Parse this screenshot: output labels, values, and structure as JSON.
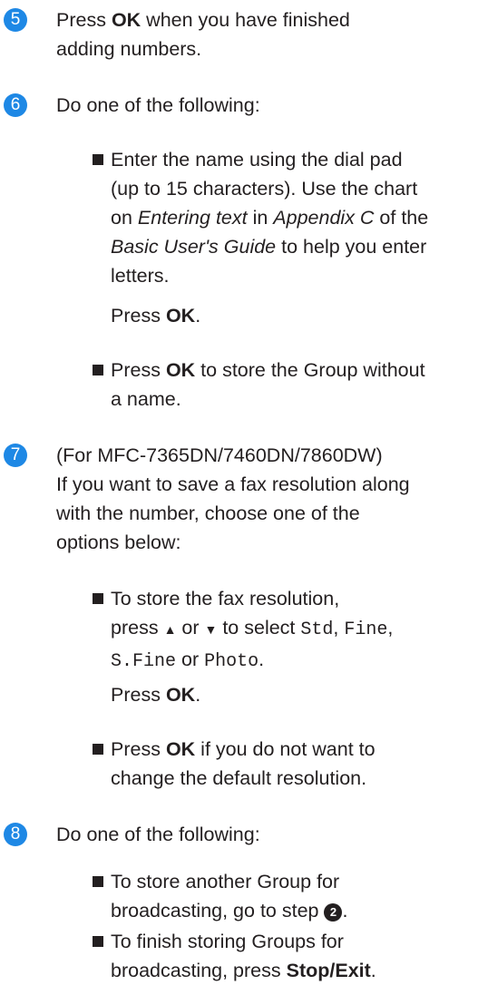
{
  "step5": {
    "number": "5",
    "text_a": "Press ",
    "ok": "OK",
    "text_b": " when you have finished",
    "line2": "adding numbers."
  },
  "step6": {
    "number": "6",
    "text": "Do one of the following:",
    "bullet1": {
      "line1": "Enter the name using the dial pad",
      "line2": "(up to 15 characters). Use the chart",
      "line3_a": "on ",
      "link1": "Entering text",
      "line3_b": " in ",
      "link2": "Appendix C",
      "line3_c": " of the",
      "link3": "Basic User's Guide",
      "line4_b": " to help you enter",
      "line5": "letters.",
      "press": "Press ",
      "ok": "OK",
      "period": "."
    },
    "bullet2": {
      "press": "Press ",
      "ok": "OK",
      "line1_b": " to store the Group without",
      "line2": "a name."
    }
  },
  "step7": {
    "number": "7",
    "line1": "(For MFC-7365DN/7460DN/7860DW)",
    "line2": "If you want to save a fax resolution along",
    "line3": "with the number, choose one of the",
    "line4": "options below:",
    "bullet1": {
      "line1": "To store the fax resolution,",
      "press": "press ",
      "up": "▲",
      "or1": " or ",
      "down": "▼",
      "to_select": " to select ",
      "opt1": "Std",
      "comma1": ", ",
      "opt2": "Fine",
      "comma2": ",",
      "opt3": "S.Fine",
      "or2": " or ",
      "opt4": "Photo",
      "period": ".",
      "press2": "Press ",
      "ok": "OK",
      "period2": "."
    },
    "bullet2": {
      "press": "Press ",
      "ok": "OK",
      "line1_b": " if you do not want to",
      "line2": "change the default resolution."
    }
  },
  "step8": {
    "number": "8",
    "text": "Do one of the following:",
    "bullet1": {
      "line1": "To store another Group for",
      "line2_a": "broadcasting, go to step ",
      "ref": "2",
      "line2_b": "."
    },
    "bullet2": {
      "line1": "To finish storing Groups for",
      "line2_a": "broadcasting, press ",
      "stop": "Stop/Exit",
      "line2_b": "."
    }
  }
}
